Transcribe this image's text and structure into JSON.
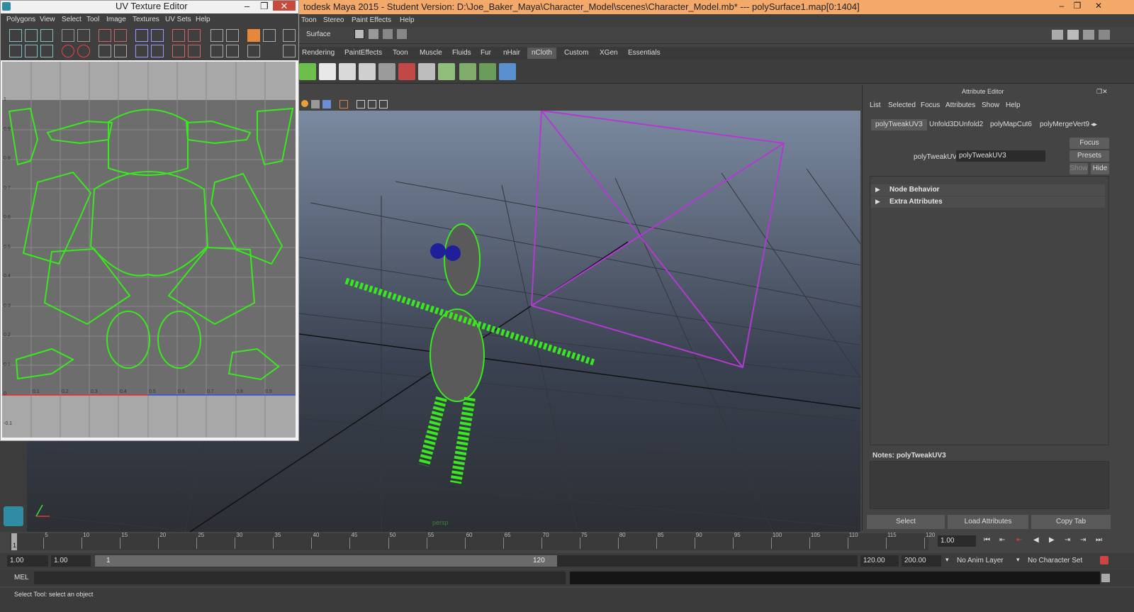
{
  "main_window": {
    "title": "todesk Maya 2015 - Student Version: D:\\Joe_Baker_Maya\\Character_Model\\scenes\\Character_Model.mb*   ---   polySurface1.map[0:1404]",
    "menus": [
      "Toon",
      "Stereo",
      "Paint Effects",
      "Help"
    ],
    "status_field": "Surface"
  },
  "shelf": {
    "tabs": [
      "Rendering",
      "PaintEffects",
      "Toon",
      "Muscle",
      "Fluids",
      "Fur",
      "nHair",
      "nCloth",
      "Custom",
      "XGen",
      "Essentials"
    ],
    "active_tab": "nCloth"
  },
  "viewport": {
    "camera_label": "persp",
    "colors": {
      "grid": "#2d2f33",
      "wire": "#ad2ec4",
      "uv_points": "#39e81e"
    }
  },
  "attribute_editor": {
    "title": "Attribute Editor",
    "menu": [
      "List",
      "Selected",
      "Focus",
      "Attributes",
      "Show",
      "Help"
    ],
    "tabs": [
      "polyTweakUV3",
      "Unfold3DUnfold2",
      "polyMapCut6",
      "polyMergeVert9"
    ],
    "node_label": "polyTweakUV:",
    "node_value": "polyTweakUV3",
    "buttons": {
      "focus": "Focus",
      "presets": "Presets",
      "show": "Show",
      "hide": "Hide"
    },
    "sections": [
      "Node Behavior",
      "Extra Attributes"
    ],
    "notes_label": "Notes: polyTweakUV3",
    "bottom_buttons": [
      "Select",
      "Load Attributes",
      "Copy Tab"
    ]
  },
  "timeline": {
    "ticks": [
      "5",
      "10",
      "15",
      "20",
      "25",
      "30",
      "35",
      "40",
      "45",
      "50",
      "55",
      "60",
      "65",
      "70",
      "75",
      "80",
      "85",
      "90",
      "95",
      "100",
      "105",
      "110",
      "115",
      "120"
    ],
    "current_frame_marker": "1",
    "current_time": "1.00"
  },
  "range": {
    "start": "1.00",
    "start2": "1.00",
    "slider_start": "1",
    "slider_end": "120",
    "end": "120.00",
    "end2": "200.00",
    "anim_layer": "No Anim Layer",
    "character_set": "No Character Set"
  },
  "command_line": {
    "label": "MEL"
  },
  "help_line": {
    "text": "Select Tool: select an object"
  },
  "uv_editor": {
    "title": "UV Texture Editor",
    "menus": [
      "Polygons",
      "View",
      "Select",
      "Tool",
      "Image",
      "Textures",
      "UV Sets",
      "Help"
    ],
    "axis_labels_y": [
      "1",
      "0.9",
      "0.8",
      "0.7",
      "0.6",
      "0.5",
      "0.4",
      "0.3",
      "0.2",
      "0.1",
      "0",
      "-0.1"
    ],
    "axis_labels_x": [
      "0.1",
      "0.2",
      "0.3",
      "0.4",
      "0.5",
      "0.6",
      "0.7",
      "0.8",
      "0.9"
    ]
  }
}
